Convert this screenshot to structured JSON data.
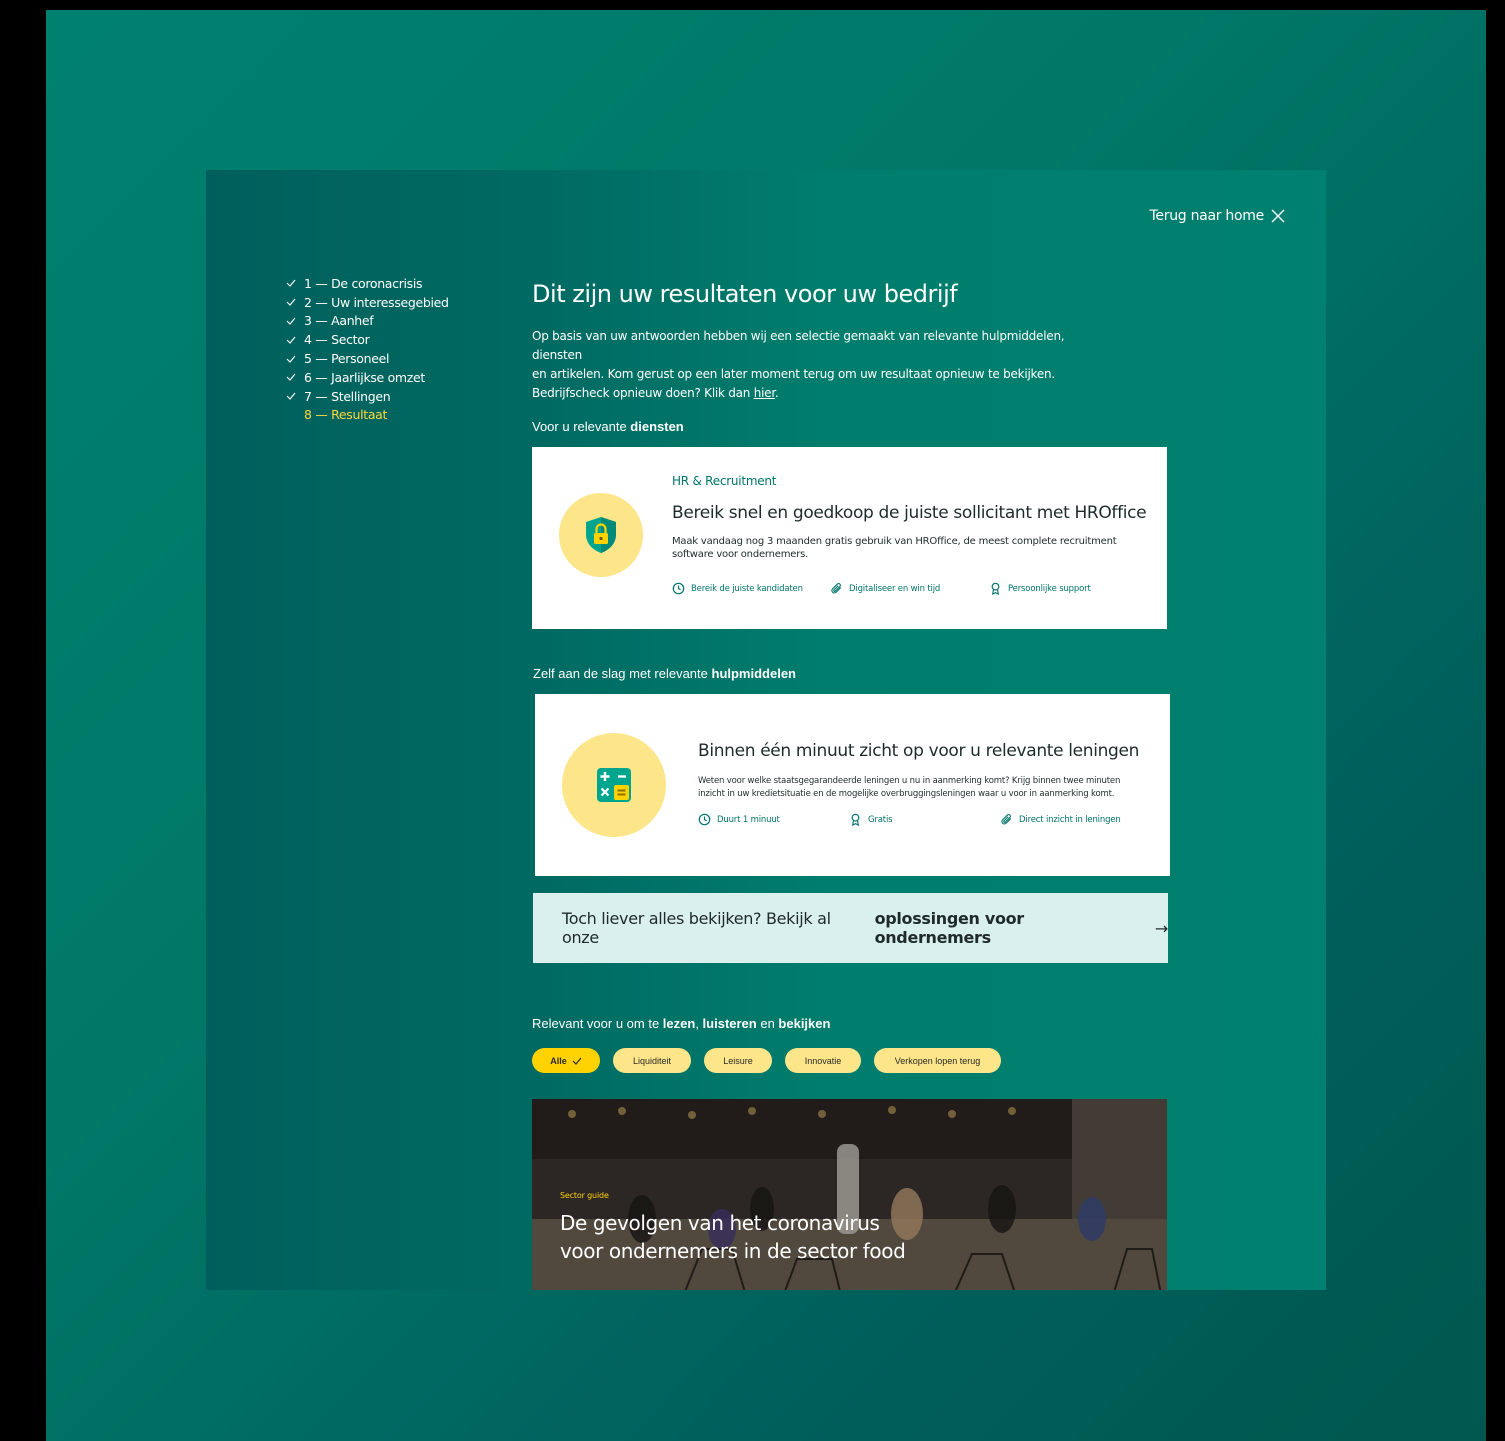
{
  "header": {
    "home_link": "Terug naar home"
  },
  "steps": [
    {
      "label": "1 — De coronacrisis",
      "done": true
    },
    {
      "label": "2 — Uw interessegebied",
      "done": true
    },
    {
      "label": "3 — Aanhef",
      "done": true
    },
    {
      "label": "4 — Sector",
      "done": true
    },
    {
      "label": "5 — Personeel",
      "done": true
    },
    {
      "label": "6 — Jaarlijkse omzet",
      "done": true
    },
    {
      "label": "7 — Stellingen",
      "done": true
    },
    {
      "label": "8 — Resultaat",
      "done": false,
      "active": true
    }
  ],
  "main": {
    "title": "Dit zijn uw resultaten voor uw bedrijf",
    "intro_line1": "Op basis van uw antwoorden hebben wij een selectie gemaakt van relevante hulpmiddelen, diensten",
    "intro_line2": "en artikelen. Kom gerust op een later moment terug om uw resultaat opnieuw te bekijken.",
    "intro_line3": "Bedrijfscheck opnieuw doen? Klik dan ",
    "intro_link": "hier",
    "intro_end": "."
  },
  "services": {
    "label_prefix": "Voor u relevante ",
    "label_bold": "diensten",
    "card": {
      "icon": "shield-lock-icon",
      "eyebrow": "HR & Recruitment",
      "title": "Bereik snel en goedkoop de juiste sollicitant met HROffice",
      "desc": "Maak vandaag nog 3 maanden gratis gebruik van HROffice, de meest complete recruitment software voor ondernemers.",
      "features": [
        {
          "icon": "clock-icon",
          "label": "Bereik de juiste kandidaten"
        },
        {
          "icon": "paperclip-icon",
          "label": "Digitaliseer en win tijd"
        },
        {
          "icon": "award-icon",
          "label": "Persoonlijke support"
        }
      ]
    }
  },
  "tools": {
    "label_prefix": "Zelf aan de slag met relevante ",
    "label_bold": "hulpmiddelen",
    "card": {
      "icon": "calculator-icon",
      "title": "Binnen één minuut zicht op voor u relevante leningen",
      "desc": "Weten voor welke staatsgegarandeerde leningen u nu in aanmerking komt? Krijg binnen twee minuten inzicht in uw kredietsituatie en de mogelijke overbruggingsleningen waar u voor in aanmerking komt.",
      "features": [
        {
          "icon": "clock-icon",
          "label": "Duurt 1 minuut"
        },
        {
          "icon": "award-icon",
          "label": "Gratis"
        },
        {
          "icon": "paperclip-icon",
          "label": "Direct inzicht in leningen"
        }
      ]
    }
  },
  "cta": {
    "prefix": "Toch liever alles bekijken? Bekijk al onze",
    "bold": "oplossingen voor ondernemers",
    "arrow": "→"
  },
  "content": {
    "label_prefix": "Relevant voor u om te ",
    "label_b1": "lezen",
    "label_sep1": ", ",
    "label_b2": "luisteren",
    "label_sep2": " en ",
    "label_b3": "bekijken",
    "filters": [
      "Alle",
      "Liquiditeit",
      "Leisure",
      "Innovatie",
      "Verkopen lopen terug"
    ],
    "active_filter": "Alle",
    "article": {
      "kicker": "Sector guide",
      "title_line1": "De gevolgen van het coronavirus",
      "title_line2": "voor ondernemers in de sector food"
    }
  },
  "colors": {
    "accent": "#ffd200",
    "teal": "#00736a",
    "chip": "#fde58a",
    "cta_bg": "#d9f0ef"
  }
}
